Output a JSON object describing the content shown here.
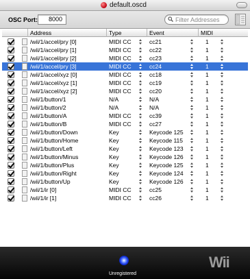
{
  "window": {
    "title": "default.oscd"
  },
  "toolbar": {
    "osc_port_label": "OSC Port:",
    "osc_port_value": "8000",
    "search_placeholder": "Filter Addresses"
  },
  "table": {
    "columns": [
      "Address",
      "Type",
      "Event",
      "MIDI"
    ],
    "rows": [
      {
        "address": "/wii/1/accel/pry [0]",
        "type": "MIDI CC",
        "event": "cc21",
        "midi": "1",
        "selected": false
      },
      {
        "address": "/wii/1/accel/pry [1]",
        "type": "MIDI CC",
        "event": "cc22",
        "midi": "1",
        "selected": false
      },
      {
        "address": "/wii/1/accel/pry [2]",
        "type": "MIDI CC",
        "event": "cc23",
        "midi": "1",
        "selected": false
      },
      {
        "address": "/wii/1/accel/pry [3]",
        "type": "MIDI CC",
        "event": "cc24",
        "midi": "1",
        "selected": true
      },
      {
        "address": "/wii/1/accel/xyz [0]",
        "type": "MIDI CC",
        "event": "cc18",
        "midi": "1",
        "selected": false
      },
      {
        "address": "/wii/1/accel/xyz [1]",
        "type": "MIDI CC",
        "event": "cc19",
        "midi": "1",
        "selected": false
      },
      {
        "address": "/wii/1/accel/xyz [2]",
        "type": "MIDI CC",
        "event": "cc20",
        "midi": "1",
        "selected": false
      },
      {
        "address": "/wii/1/button/1",
        "type": "N/A",
        "event": "N/A",
        "midi": "1",
        "selected": false
      },
      {
        "address": "/wii/1/button/2",
        "type": "N/A",
        "event": "N/A",
        "midi": "1",
        "selected": false
      },
      {
        "address": "/wii/1/button/A",
        "type": "MIDI CC",
        "event": "cc39",
        "midi": "1",
        "selected": false
      },
      {
        "address": "/wii/1/button/B",
        "type": "MIDI CC",
        "event": "cc27",
        "midi": "1",
        "selected": false
      },
      {
        "address": "/wii/1/button/Down",
        "type": "Key",
        "event": "Keycode 125",
        "midi": "1",
        "selected": false
      },
      {
        "address": "/wii/1/button/Home",
        "type": "Key",
        "event": "Keycode 115",
        "midi": "1",
        "selected": false
      },
      {
        "address": "/wii/1/button/Left",
        "type": "Key",
        "event": "Keycode 123",
        "midi": "1",
        "selected": false
      },
      {
        "address": "/wii/1/button/Minus",
        "type": "Key",
        "event": "Keycode 126",
        "midi": "1",
        "selected": false
      },
      {
        "address": "/wii/1/button/Plus",
        "type": "Key",
        "event": "Keycode 125",
        "midi": "1",
        "selected": false
      },
      {
        "address": "/wii/1/button/Right",
        "type": "Key",
        "event": "Keycode 124",
        "midi": "1",
        "selected": false
      },
      {
        "address": "/wii/1/button/Up",
        "type": "Key",
        "event": "Keycode 126",
        "midi": "1",
        "selected": false
      },
      {
        "address": "/wii/1/ir [0]",
        "type": "MIDI CC",
        "event": "cc25",
        "midi": "1",
        "selected": false
      },
      {
        "address": "/wii/1/ir [1]",
        "type": "MIDI CC",
        "event": "cc26",
        "midi": "1",
        "selected": false
      }
    ]
  },
  "status": {
    "label": "Unregistered"
  },
  "logo": {
    "text": "Wii"
  },
  "colors": {
    "selection": "#3874d8",
    "status_light": "#1030e0"
  }
}
